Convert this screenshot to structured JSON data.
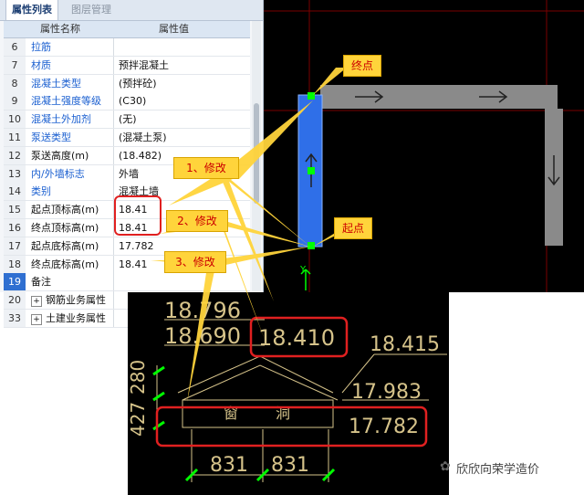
{
  "tabs": {
    "properties": "属性列表",
    "layers": "图层管理"
  },
  "columns": {
    "name": "属性名称",
    "value": "属性值"
  },
  "rows": [
    {
      "num": "6",
      "name": "拉筋",
      "value": "",
      "color": "blue"
    },
    {
      "num": "7",
      "name": "材质",
      "value": "预拌混凝土",
      "color": "blue"
    },
    {
      "num": "8",
      "name": "混凝土类型",
      "value": "(预拌砼)",
      "color": "blue"
    },
    {
      "num": "9",
      "name": "混凝土强度等级",
      "value": "(C30)",
      "color": "blue"
    },
    {
      "num": "10",
      "name": "混凝土外加剂",
      "value": "(无)",
      "color": "blue"
    },
    {
      "num": "11",
      "name": "泵送类型",
      "value": "(混凝土泵)",
      "color": "blue"
    },
    {
      "num": "12",
      "name": "泵送高度(m)",
      "value": "(18.482)",
      "color": "black"
    },
    {
      "num": "13",
      "name": "内/外墙标志",
      "value": "外墙",
      "color": "blue"
    },
    {
      "num": "14",
      "name": "类别",
      "value": "混凝土墙",
      "color": "blue"
    },
    {
      "num": "15",
      "name": "起点顶标高(m)",
      "value": "18.41",
      "color": "black"
    },
    {
      "num": "16",
      "name": "终点顶标高(m)",
      "value": "18.41",
      "color": "black"
    },
    {
      "num": "17",
      "name": "起点底标高(m)",
      "value": "17.782",
      "color": "black"
    },
    {
      "num": "18",
      "name": "终点底标高(m)",
      "value": "18.41",
      "color": "black"
    },
    {
      "num": "19",
      "name": "备注",
      "value": "",
      "color": "black"
    },
    {
      "num": "20",
      "name": "钢筋业务属性",
      "value": "",
      "color": "black",
      "expander": "+"
    },
    {
      "num": "33",
      "name": "土建业务属性",
      "value": "",
      "color": "black",
      "expander": "+"
    }
  ],
  "callouts": {
    "end_point": "终点",
    "start_point": "起点",
    "modify1": "1、修改",
    "modify2": "2、修改",
    "modify3": "3、修改"
  },
  "cad": {
    "y_axis": "Y",
    "dims": {
      "d1": "18.796",
      "d2": "18.690",
      "d3": "18.410",
      "d4": "18.415",
      "d5": "17.983",
      "d6": "17.782",
      "d7": "280",
      "d8": "427",
      "d9": "831",
      "d10": "831",
      "window": "窗",
      "opening": "洞"
    }
  },
  "watermark": "欣欣向荣学造价",
  "colors": {
    "highlight_red": "#e02020",
    "callout_yellow": "#ffd43b",
    "wall_blue": "#2f6fe8",
    "cad_green": "#00ff00"
  }
}
